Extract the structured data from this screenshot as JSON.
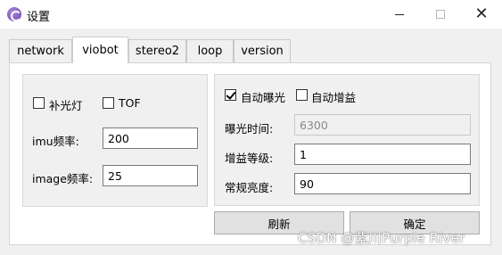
{
  "window": {
    "title": "设置",
    "close_glyph": "✕"
  },
  "tabs": [
    {
      "label": "network"
    },
    {
      "label": "viobot"
    },
    {
      "label": "stereo2"
    },
    {
      "label": "loop"
    },
    {
      "label": "version"
    }
  ],
  "active_tab": "viobot",
  "left_group": {
    "fill_light": {
      "label": "补光灯",
      "checked": false
    },
    "tof": {
      "label": "TOF",
      "checked": false
    },
    "imu_freq": {
      "label": "imu频率:",
      "value": "200"
    },
    "image_freq": {
      "label": "image频率:",
      "value": "25"
    }
  },
  "right_group": {
    "auto_exposure": {
      "label": "自动曝光",
      "checked": true
    },
    "auto_gain": {
      "label": "自动增益",
      "checked": false
    },
    "exposure_time": {
      "label": "曝光时间:",
      "value": "6300",
      "disabled": true
    },
    "gain_level": {
      "label": "增益等级:",
      "value": "1"
    },
    "brightness": {
      "label": "常规亮度:",
      "value": "90"
    }
  },
  "buttons": {
    "refresh": "刷新",
    "confirm": "确定"
  },
  "watermark": "CSDN @紫川Purple River"
}
